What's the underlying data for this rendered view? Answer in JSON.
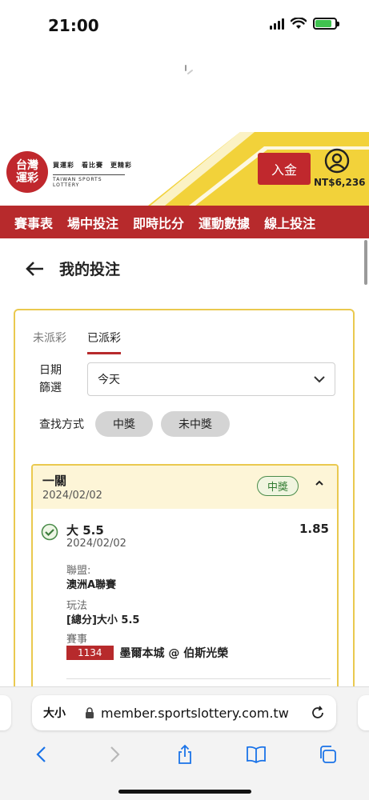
{
  "status_bar": {
    "time": "21:00",
    "battery_level": 0.85
  },
  "header": {
    "logo_text": "台灣\n運彩",
    "slogan": "買運彩　看比賽　更精彩",
    "english_name": "TAIWAN SPORTS LOTTERY",
    "deposit_label": "入金",
    "balance": "NT$6,236",
    "colors": {
      "brand_red": "#c0282d",
      "accent_yellow": "#f2d23a"
    }
  },
  "nav": {
    "items": [
      {
        "label": "賽事表"
      },
      {
        "label": "場中投注"
      },
      {
        "label": "即時比分"
      },
      {
        "label": "運動數據"
      },
      {
        "label": "線上投注"
      }
    ]
  },
  "page": {
    "title": "我的投注"
  },
  "tabs": [
    {
      "label": "未派彩",
      "active": false
    },
    {
      "label": "已派彩",
      "active": true
    }
  ],
  "filter": {
    "date_label": "日期\n篩選",
    "date_value": "今天",
    "search_label": "查找方式",
    "options": [
      {
        "label": "中獎"
      },
      {
        "label": "未中獎"
      }
    ]
  },
  "bet": {
    "type": "一關",
    "date": "2024/02/02",
    "status": "中獎",
    "selection": {
      "name": "大 5.5",
      "date": "2024/02/02",
      "odds": "1.85",
      "league_label": "聯盟:",
      "league": "澳洲A聯賽",
      "play_label": "玩法",
      "play": "[總分]大小 5.5",
      "event_label": "賽事",
      "match_no": "1134",
      "match": "墨爾本城 @ 伯斯光榮"
    }
  },
  "browser": {
    "text_size": "大小",
    "url": "member.sportslottery.com.tw"
  }
}
